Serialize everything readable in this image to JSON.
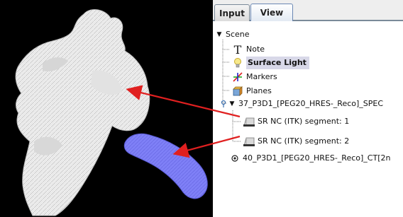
{
  "tabs": [
    {
      "label": "Input",
      "active": false
    },
    {
      "label": "View",
      "active": true
    }
  ],
  "tree": {
    "scene": {
      "label": "Scene",
      "expanded": true
    },
    "children": [
      {
        "label": "Note",
        "icon": "text-t-icon"
      },
      {
        "label": "Surface Light",
        "icon": "lightbulb-icon",
        "selected": true
      },
      {
        "label": "Markers",
        "icon": "axes-markers-icon"
      },
      {
        "label": "Planes",
        "icon": "planes-cube-icon"
      }
    ],
    "series": [
      {
        "label": "37_P3D1_[PEG20_HRES-_Reco]_SPEC",
        "expanded": true,
        "segments": [
          {
            "label": "SR NC (ITK) segment: 1",
            "color": "#d9d9d9"
          },
          {
            "label": "SR NC (ITK) segment: 2",
            "color": "#d9d9d9"
          }
        ]
      },
      {
        "label": "40_P3D1_[PEG20_HRES-_Reco]_CT[2n",
        "expanded": false
      }
    ]
  },
  "viewport": {
    "background": "#000000",
    "surface_white_color": "#f2f2f2",
    "surface_blue_color": "#7b7cf5",
    "arrow_color": "#e02020"
  }
}
